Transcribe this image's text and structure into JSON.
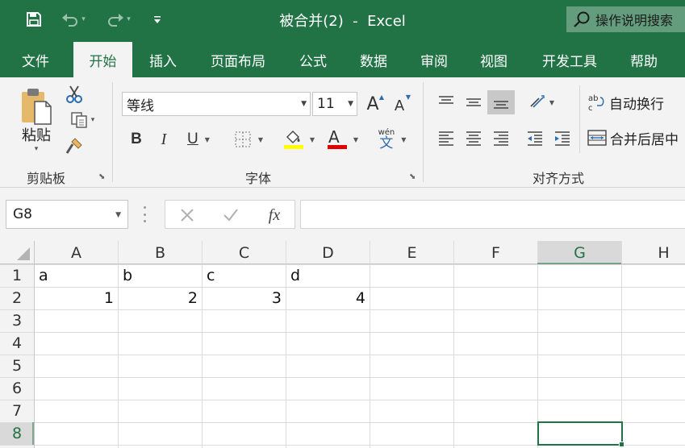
{
  "window": {
    "title": "被合并(2)  -  Excel",
    "tell_me": "操作说明搜索"
  },
  "quick_access": {
    "save_icon": "save-icon",
    "undo_icon": "undo-icon",
    "redo_icon": "redo-icon",
    "customize_icon": "customize-qat-icon"
  },
  "tabs": [
    {
      "label": "文件",
      "active": false
    },
    {
      "label": "开始",
      "active": true
    },
    {
      "label": "插入",
      "active": false
    },
    {
      "label": "页面布局",
      "active": false
    },
    {
      "label": "公式",
      "active": false
    },
    {
      "label": "数据",
      "active": false
    },
    {
      "label": "审阅",
      "active": false
    },
    {
      "label": "视图",
      "active": false
    },
    {
      "label": "开发工具",
      "active": false
    },
    {
      "label": "帮助",
      "active": false
    }
  ],
  "ribbon": {
    "clipboard": {
      "label": "剪贴板",
      "paste_label": "粘贴"
    },
    "font": {
      "label": "字体",
      "font_name": "等线",
      "font_size": "11",
      "bold": "B",
      "italic": "I",
      "underline": "U",
      "font_color_letter": "A",
      "grow_letter": "A",
      "shrink_letter": "A",
      "pinyin_top": "wén",
      "pinyin_char": "文",
      "highlight_color": "#ffff00",
      "font_color": "#e00000"
    },
    "alignment": {
      "label": "对齐方式",
      "wrap_text": "自动换行",
      "merge_center": "合并后居中",
      "wrap_icon_text": "ab c"
    }
  },
  "formula_bar": {
    "name_box": "G8",
    "formula": "",
    "fx_label": "fx"
  },
  "sheet": {
    "columns": [
      "A",
      "B",
      "C",
      "D",
      "E",
      "F",
      "G",
      "H"
    ],
    "rows": [
      "1",
      "2",
      "3",
      "4",
      "5",
      "6",
      "7",
      "8"
    ],
    "selected_column": "G",
    "selected_row": "8",
    "cells": {
      "A1": "a",
      "B1": "b",
      "C1": "c",
      "D1": "d",
      "A2": "1",
      "B2": "2",
      "C2": "3",
      "D2": "4"
    }
  },
  "colors": {
    "brand": "#217346",
    "ribbon_bg": "#f3f3f3",
    "selection": "#217346"
  }
}
